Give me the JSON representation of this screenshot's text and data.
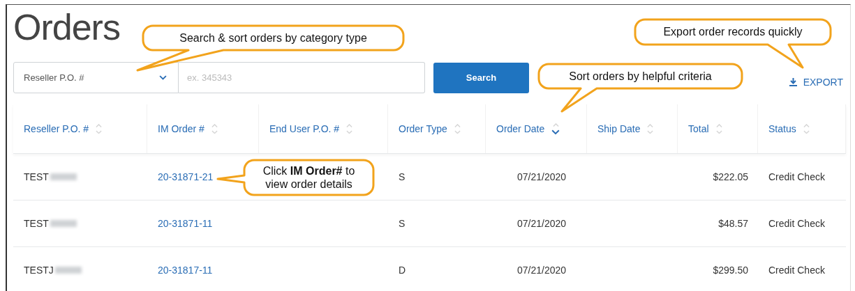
{
  "title": "Orders",
  "search": {
    "category": "Reseller P.O. #",
    "placeholder": "ex. 345343",
    "button": "Search"
  },
  "export": "EXPORT",
  "table": {
    "columns": [
      {
        "label": "Reseller P.O. #",
        "sorted": false
      },
      {
        "label": "IM Order #",
        "sorted": false
      },
      {
        "label": "End User P.O. #",
        "sorted": false
      },
      {
        "label": "Order Type",
        "sorted": false
      },
      {
        "label": "Order Date",
        "sorted": true
      },
      {
        "label": "Ship Date",
        "sorted": false
      },
      {
        "label": "Total",
        "sorted": false
      },
      {
        "label": "Status",
        "sorted": false
      }
    ],
    "rows": [
      {
        "reseller_po": "TEST",
        "redacted": true,
        "im_order": "20-31871-21",
        "order_type": "S",
        "order_date": "07/21/2020",
        "total": "$222.05",
        "status": "Credit Check"
      },
      {
        "reseller_po": "TEST",
        "redacted": true,
        "im_order": "20-31871-11",
        "order_type": "S",
        "order_date": "07/21/2020",
        "total": "$48.57",
        "status": "Credit Check"
      },
      {
        "reseller_po": "TESTJ",
        "redacted": true,
        "im_order": "20-31817-11",
        "order_type": "D",
        "order_date": "07/21/2020",
        "total": "$299.50",
        "status": "Credit Check"
      }
    ]
  },
  "callouts": [
    {
      "text": "Search & sort orders by category type"
    },
    {
      "text": "Export order records quickly"
    },
    {
      "text": "Sort orders by helpful criteria"
    },
    {
      "text": "Click **IM Order#** to view order details"
    }
  ]
}
